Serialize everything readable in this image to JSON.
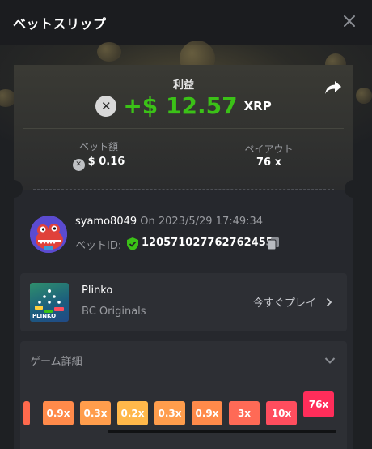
{
  "header": {
    "title": "ベットスリップ",
    "close_icon": "close-icon"
  },
  "summary": {
    "profit_label": "利益",
    "profit_value": "+$ 12.57",
    "currency": "XRP",
    "currency_icon": "xrp-icon",
    "share_icon": "share-arrow-icon",
    "bet_amount_label": "ベット額",
    "bet_amount_value": "$ 0.16",
    "payout_label": "ペイアウト",
    "payout_value": "76 x",
    "profit_color": "#3bc117"
  },
  "user": {
    "name": "syamo8049",
    "date": "On 2023/5/29 17:49:34",
    "bet_id_label": "ベットID:",
    "bet_id": "120571027762762455",
    "verified_icon": "shield-check-icon",
    "copy_icon": "copy-icon",
    "avatar_icon": "avatar-crocodile"
  },
  "game": {
    "name": "Plinko",
    "provider": "BC Originals",
    "play_label": "今すぐプレイ",
    "thumbnail_label": "PLINKO"
  },
  "details": {
    "title": "ゲーム詳細",
    "buckets": [
      {
        "label": "",
        "color": "#ff6a4d"
      },
      {
        "label": "0.9x",
        "color": "#ff8a4a"
      },
      {
        "label": "0.3x",
        "color": "#ff9d4c"
      },
      {
        "label": "0.2x",
        "color": "#ffb84a"
      },
      {
        "label": "0.3x",
        "color": "#ff9d4c"
      },
      {
        "label": "0.9x",
        "color": "#ff8a4a"
      },
      {
        "label": "3x",
        "color": "#ff6a56"
      },
      {
        "label": "10x",
        "color": "#ff4d5e"
      },
      {
        "label": "76x",
        "color": "#ff2d5a",
        "highlighted": true
      }
    ]
  }
}
